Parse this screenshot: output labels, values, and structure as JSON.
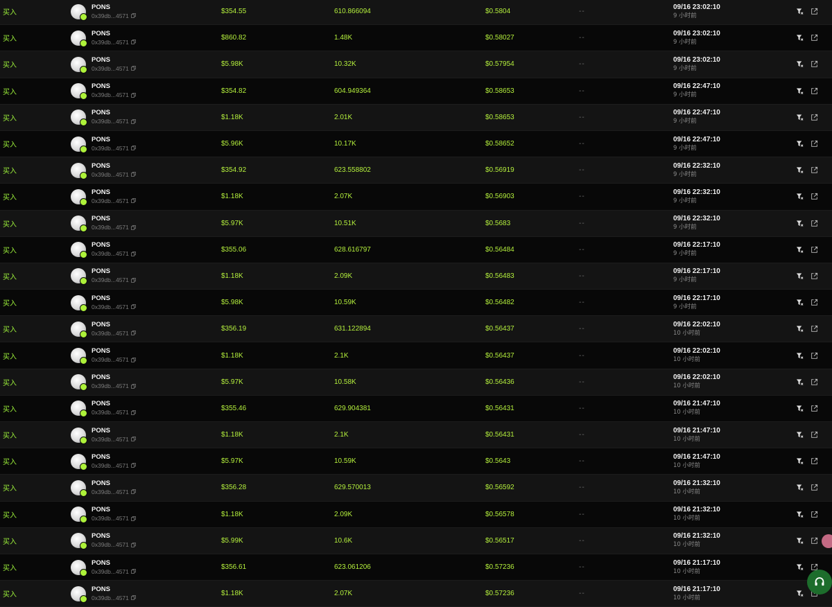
{
  "table": {
    "rows": [
      {
        "type": "买入",
        "symbol": "PONS",
        "address": "0x39db...4571",
        "usd": "$354.55",
        "quantity": "610.866094",
        "price": "$0.5804",
        "maker": "--",
        "time": "09/16 23:02:10",
        "ago": "9 小时前"
      },
      {
        "type": "买入",
        "symbol": "PONS",
        "address": "0x39db...4571",
        "usd": "$860.82",
        "quantity": "1.48K",
        "price": "$0.58027",
        "maker": "--",
        "time": "09/16 23:02:10",
        "ago": "9 小时前"
      },
      {
        "type": "买入",
        "symbol": "PONS",
        "address": "0x39db...4571",
        "usd": "$5.98K",
        "quantity": "10.32K",
        "price": "$0.57954",
        "maker": "--",
        "time": "09/16 23:02:10",
        "ago": "9 小时前"
      },
      {
        "type": "买入",
        "symbol": "PONS",
        "address": "0x39db...4571",
        "usd": "$354.82",
        "quantity": "604.949364",
        "price": "$0.58653",
        "maker": "--",
        "time": "09/16 22:47:10",
        "ago": "9 小时前"
      },
      {
        "type": "买入",
        "symbol": "PONS",
        "address": "0x39db...4571",
        "usd": "$1.18K",
        "quantity": "2.01K",
        "price": "$0.58653",
        "maker": "--",
        "time": "09/16 22:47:10",
        "ago": "9 小时前"
      },
      {
        "type": "买入",
        "symbol": "PONS",
        "address": "0x39db...4571",
        "usd": "$5.96K",
        "quantity": "10.17K",
        "price": "$0.58652",
        "maker": "--",
        "time": "09/16 22:47:10",
        "ago": "9 小时前"
      },
      {
        "type": "买入",
        "symbol": "PONS",
        "address": "0x39db...4571",
        "usd": "$354.92",
        "quantity": "623.558802",
        "price": "$0.56919",
        "maker": "--",
        "time": "09/16 22:32:10",
        "ago": "9 小时前"
      },
      {
        "type": "买入",
        "symbol": "PONS",
        "address": "0x39db...4571",
        "usd": "$1.18K",
        "quantity": "2.07K",
        "price": "$0.56903",
        "maker": "--",
        "time": "09/16 22:32:10",
        "ago": "9 小时前"
      },
      {
        "type": "买入",
        "symbol": "PONS",
        "address": "0x39db...4571",
        "usd": "$5.97K",
        "quantity": "10.51K",
        "price": "$0.5683",
        "maker": "--",
        "time": "09/16 22:32:10",
        "ago": "9 小时前"
      },
      {
        "type": "买入",
        "symbol": "PONS",
        "address": "0x39db...4571",
        "usd": "$355.06",
        "quantity": "628.616797",
        "price": "$0.56484",
        "maker": "--",
        "time": "09/16 22:17:10",
        "ago": "9 小时前"
      },
      {
        "type": "买入",
        "symbol": "PONS",
        "address": "0x39db...4571",
        "usd": "$1.18K",
        "quantity": "2.09K",
        "price": "$0.56483",
        "maker": "--",
        "time": "09/16 22:17:10",
        "ago": "9 小时前"
      },
      {
        "type": "买入",
        "symbol": "PONS",
        "address": "0x39db...4571",
        "usd": "$5.98K",
        "quantity": "10.59K",
        "price": "$0.56482",
        "maker": "--",
        "time": "09/16 22:17:10",
        "ago": "9 小时前"
      },
      {
        "type": "买入",
        "symbol": "PONS",
        "address": "0x39db...4571",
        "usd": "$356.19",
        "quantity": "631.122894",
        "price": "$0.56437",
        "maker": "--",
        "time": "09/16 22:02:10",
        "ago": "10 小时前"
      },
      {
        "type": "买入",
        "symbol": "PONS",
        "address": "0x39db...4571",
        "usd": "$1.18K",
        "quantity": "2.1K",
        "price": "$0.56437",
        "maker": "--",
        "time": "09/16 22:02:10",
        "ago": "10 小时前"
      },
      {
        "type": "买入",
        "symbol": "PONS",
        "address": "0x39db...4571",
        "usd": "$5.97K",
        "quantity": "10.58K",
        "price": "$0.56436",
        "maker": "--",
        "time": "09/16 22:02:10",
        "ago": "10 小时前"
      },
      {
        "type": "买入",
        "symbol": "PONS",
        "address": "0x39db...4571",
        "usd": "$355.46",
        "quantity": "629.904381",
        "price": "$0.56431",
        "maker": "--",
        "time": "09/16 21:47:10",
        "ago": "10 小时前"
      },
      {
        "type": "买入",
        "symbol": "PONS",
        "address": "0x39db...4571",
        "usd": "$1.18K",
        "quantity": "2.1K",
        "price": "$0.56431",
        "maker": "--",
        "time": "09/16 21:47:10",
        "ago": "10 小时前"
      },
      {
        "type": "买入",
        "symbol": "PONS",
        "address": "0x39db...4571",
        "usd": "$5.97K",
        "quantity": "10.59K",
        "price": "$0.5643",
        "maker": "--",
        "time": "09/16 21:47:10",
        "ago": "10 小时前"
      },
      {
        "type": "买入",
        "symbol": "PONS",
        "address": "0x39db...4571",
        "usd": "$356.28",
        "quantity": "629.570013",
        "price": "$0.56592",
        "maker": "--",
        "time": "09/16 21:32:10",
        "ago": "10 小时前"
      },
      {
        "type": "买入",
        "symbol": "PONS",
        "address": "0x39db...4571",
        "usd": "$1.18K",
        "quantity": "2.09K",
        "price": "$0.56578",
        "maker": "--",
        "time": "09/16 21:32:10",
        "ago": "10 小时前"
      },
      {
        "type": "买入",
        "symbol": "PONS",
        "address": "0x39db...4571",
        "usd": "$5.99K",
        "quantity": "10.6K",
        "price": "$0.56517",
        "maker": "--",
        "time": "09/16 21:32:10",
        "ago": "10 小时前"
      },
      {
        "type": "买入",
        "symbol": "PONS",
        "address": "0x39db...4571",
        "usd": "$356.61",
        "quantity": "623.061206",
        "price": "$0.57236",
        "maker": "--",
        "time": "09/16 21:17:10",
        "ago": "10 小时前"
      },
      {
        "type": "买入",
        "symbol": "PONS",
        "address": "0x39db...4571",
        "usd": "$1.18K",
        "quantity": "2.07K",
        "price": "$0.57236",
        "maker": "--",
        "time": "09/16 21:17:10",
        "ago": "10 小时前"
      }
    ],
    "row_icons": {
      "filter": "filter-icon",
      "open": "external-link-icon",
      "copy": "copy-icon",
      "avatar": "token-avatar",
      "badge": "chain-badge"
    }
  },
  "floating": {
    "pink_icon": "tool-bubble-icon",
    "support_icon": "headset-icon"
  },
  "colors": {
    "buy": "#9cf03a",
    "value": "#b6f23d",
    "row_odd": "#141414",
    "row_even": "#080808",
    "muted": "#7b7b7b",
    "support_button": "#1d6d2c"
  }
}
